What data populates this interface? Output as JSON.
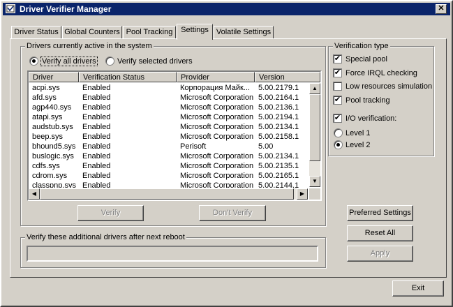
{
  "window": {
    "title": "Driver Verifier Manager",
    "close_glyph": "✕"
  },
  "tabs": [
    {
      "label": "Driver Status"
    },
    {
      "label": "Global Counters"
    },
    {
      "label": "Pool Tracking"
    },
    {
      "label": "Settings",
      "active": true
    },
    {
      "label": "Volatile Settings"
    }
  ],
  "drivers_group": {
    "title": "Drivers currently active in the system",
    "radio_all": "Verify all drivers",
    "radio_selected": "Verify selected drivers",
    "selected_mode": "all",
    "columns": [
      "Driver",
      "Verification Status",
      "Provider",
      "Version"
    ],
    "rows": [
      [
        "acpi.sys",
        "Enabled",
        "Корпорация Майк...",
        "5.00.2179.1"
      ],
      [
        "afd.sys",
        "Enabled",
        "Microsoft Corporation",
        "5.00.2164.1"
      ],
      [
        "agp440.sys",
        "Enabled",
        "Microsoft Corporation",
        "5.00.2136.1"
      ],
      [
        "atapi.sys",
        "Enabled",
        "Microsoft Corporation",
        "5.00.2194.1"
      ],
      [
        "audstub.sys",
        "Enabled",
        "Microsoft Corporation",
        "5.00.2134.1"
      ],
      [
        "beep.sys",
        "Enabled",
        "Microsoft Corporation",
        "5.00.2158.1"
      ],
      [
        "bhound5.sys",
        "Enabled",
        "Perisoft",
        "5.00"
      ],
      [
        "buslogic.sys",
        "Enabled",
        "Microsoft Corporation",
        "5.00.2134.1"
      ],
      [
        "cdfs.sys",
        "Enabled",
        "Microsoft Corporation",
        "5.00.2135.1"
      ],
      [
        "cdrom.sys",
        "Enabled",
        "Microsoft Corporation",
        "5.00.2165.1"
      ],
      [
        "classpnp.sys",
        "Enabled",
        "Microsoft Corporation",
        "5.00.2144.1"
      ]
    ],
    "verify_button": "Verify",
    "dont_verify_button": "Don't Verify"
  },
  "additional_group": {
    "title": "Verify these additional drivers after next reboot",
    "value": ""
  },
  "verification_type": {
    "title": "Verification type",
    "options": [
      {
        "label": "Special pool",
        "checked": true
      },
      {
        "label": "Force IRQL checking",
        "checked": true
      },
      {
        "label": "Low resources simulation",
        "checked": false
      },
      {
        "label": "Pool tracking",
        "checked": true
      }
    ],
    "io_verification": {
      "label": "I/O verification:",
      "checked": true
    },
    "levels": [
      {
        "label": "Level 1",
        "selected": false
      },
      {
        "label": "Level 2",
        "selected": true
      }
    ]
  },
  "buttons": {
    "preferred_settings": "Preferred Settings",
    "reset_all": "Reset All",
    "apply": "Apply",
    "exit": "Exit"
  },
  "check_glyph": "✔"
}
